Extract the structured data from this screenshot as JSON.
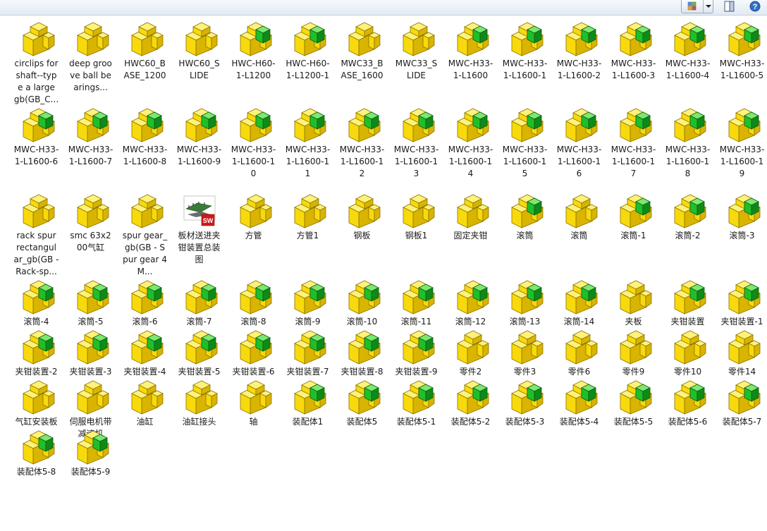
{
  "toolbar": {
    "view_icon": "view-options-icon",
    "dropdown_icon": "chevron-down-icon",
    "pane_icon": "preview-pane-icon",
    "help_icon": "help-icon"
  },
  "colors": {
    "part_yellow": "#f8d90c",
    "assembly_green": "#1fbf2a",
    "drawing_red": "#d01818"
  },
  "files": [
    {
      "name": "circlips for shaft--type a large gb(GB_C...",
      "type": "part"
    },
    {
      "name": "deep groove ball bearings...",
      "type": "part"
    },
    {
      "name": "HWC60_BASE_1200",
      "type": "part"
    },
    {
      "name": "HWC60_SLIDE",
      "type": "part"
    },
    {
      "name": "HWC-H60-1-L1200",
      "type": "assembly"
    },
    {
      "name": "HWC-H60-1-L1200-1",
      "type": "assembly"
    },
    {
      "name": "MWC33_BASE_1600",
      "type": "part"
    },
    {
      "name": "MWC33_SLIDE",
      "type": "part"
    },
    {
      "name": "MWC-H33-1-L1600",
      "type": "assembly"
    },
    {
      "name": "MWC-H33-1-L1600-1",
      "type": "assembly"
    },
    {
      "name": "MWC-H33-1-L1600-2",
      "type": "assembly"
    },
    {
      "name": "MWC-H33-1-L1600-3",
      "type": "assembly"
    },
    {
      "name": "MWC-H33-1-L1600-4",
      "type": "assembly"
    },
    {
      "name": "MWC-H33-1-L1600-5",
      "type": "assembly"
    },
    {
      "name": "MWC-H33-1-L1600-6",
      "type": "assembly"
    },
    {
      "name": "MWC-H33-1-L1600-7",
      "type": "assembly"
    },
    {
      "name": "MWC-H33-1-L1600-8",
      "type": "assembly"
    },
    {
      "name": "MWC-H33-1-L1600-9",
      "type": "assembly"
    },
    {
      "name": "MWC-H33-1-L1600-10",
      "type": "assembly"
    },
    {
      "name": "MWC-H33-1-L1600-11",
      "type": "assembly"
    },
    {
      "name": "MWC-H33-1-L1600-12",
      "type": "assembly"
    },
    {
      "name": "MWC-H33-1-L1600-13",
      "type": "assembly"
    },
    {
      "name": "MWC-H33-1-L1600-14",
      "type": "assembly"
    },
    {
      "name": "MWC-H33-1-L1600-15",
      "type": "assembly"
    },
    {
      "name": "MWC-H33-1-L1600-16",
      "type": "assembly"
    },
    {
      "name": "MWC-H33-1-L1600-17",
      "type": "assembly"
    },
    {
      "name": "MWC-H33-1-L1600-18",
      "type": "assembly"
    },
    {
      "name": "MWC-H33-1-L1600-19",
      "type": "assembly"
    },
    {
      "name": "rack spur rectangular_gb(GB - Rack-sp...",
      "type": "part"
    },
    {
      "name": "smc 63x200气缸",
      "type": "part"
    },
    {
      "name": "spur gear_gb(GB - Spur gear 4M...",
      "type": "part"
    },
    {
      "name": "板材送进夹钳装置总装图",
      "type": "drawing"
    },
    {
      "name": "方管",
      "type": "part"
    },
    {
      "name": "方管1",
      "type": "part"
    },
    {
      "name": "钢板",
      "type": "part"
    },
    {
      "name": "钢板1",
      "type": "part"
    },
    {
      "name": "固定夹钳",
      "type": "part"
    },
    {
      "name": "滚筒",
      "type": "assembly"
    },
    {
      "name": "滚筒",
      "type": "part"
    },
    {
      "name": "滚筒-1",
      "type": "assembly"
    },
    {
      "name": "滚筒-2",
      "type": "assembly"
    },
    {
      "name": "滚筒-3",
      "type": "assembly"
    },
    {
      "name": "滚筒-4",
      "type": "assembly"
    },
    {
      "name": "滚筒-5",
      "type": "assembly"
    },
    {
      "name": "滚筒-6",
      "type": "assembly"
    },
    {
      "name": "滚筒-7",
      "type": "assembly"
    },
    {
      "name": "滚筒-8",
      "type": "assembly"
    },
    {
      "name": "滚筒-9",
      "type": "assembly"
    },
    {
      "name": "滚筒-10",
      "type": "assembly"
    },
    {
      "name": "滚筒-11",
      "type": "assembly"
    },
    {
      "name": "滚筒-12",
      "type": "assembly"
    },
    {
      "name": "滚筒-13",
      "type": "assembly"
    },
    {
      "name": "滚筒-14",
      "type": "assembly"
    },
    {
      "name": "夹板",
      "type": "part"
    },
    {
      "name": "夹钳装置",
      "type": "assembly"
    },
    {
      "name": "夹钳装置-1",
      "type": "assembly"
    },
    {
      "name": "夹钳装置-2",
      "type": "assembly"
    },
    {
      "name": "夹钳装置-3",
      "type": "assembly"
    },
    {
      "name": "夹钳装置-4",
      "type": "assembly"
    },
    {
      "name": "夹钳装置-5",
      "type": "assembly"
    },
    {
      "name": "夹钳装置-6",
      "type": "assembly"
    },
    {
      "name": "夹钳装置-7",
      "type": "assembly"
    },
    {
      "name": "夹钳装置-8",
      "type": "assembly"
    },
    {
      "name": "夹钳装置-9",
      "type": "assembly"
    },
    {
      "name": "零件2",
      "type": "part"
    },
    {
      "name": "零件3",
      "type": "part"
    },
    {
      "name": "零件6",
      "type": "part"
    },
    {
      "name": "零件9",
      "type": "part"
    },
    {
      "name": "零件10",
      "type": "part"
    },
    {
      "name": "零件14",
      "type": "part"
    },
    {
      "name": "气缸安装板",
      "type": "part"
    },
    {
      "name": "伺服电机带减速机",
      "type": "part"
    },
    {
      "name": "油缸",
      "type": "part"
    },
    {
      "name": "油缸接头",
      "type": "part"
    },
    {
      "name": "轴",
      "type": "part"
    },
    {
      "name": "装配体1",
      "type": "assembly"
    },
    {
      "name": "装配体5",
      "type": "assembly"
    },
    {
      "name": "装配体5-1",
      "type": "assembly"
    },
    {
      "name": "装配体5-2",
      "type": "assembly"
    },
    {
      "name": "装配体5-3",
      "type": "assembly"
    },
    {
      "name": "装配体5-4",
      "type": "assembly"
    },
    {
      "name": "装配体5-5",
      "type": "assembly"
    },
    {
      "name": "装配体5-6",
      "type": "assembly"
    },
    {
      "name": "装配体5-7",
      "type": "assembly"
    },
    {
      "name": "装配体5-8",
      "type": "assembly"
    },
    {
      "name": "装配体5-9",
      "type": "assembly"
    }
  ]
}
